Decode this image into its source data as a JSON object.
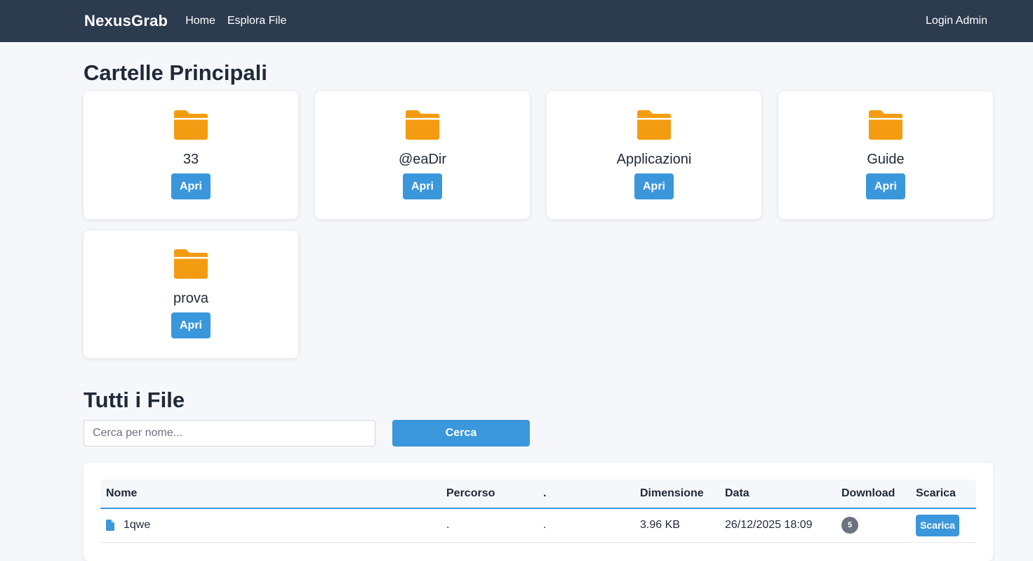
{
  "navbar": {
    "brand": "NexusGrab",
    "links": [
      "Home",
      "Esplora File"
    ],
    "login": "Login Admin"
  },
  "folders_section": {
    "title": "Cartelle Principali",
    "open_label": "Apri",
    "folders": [
      {
        "name": "33"
      },
      {
        "name": "@eaDir"
      },
      {
        "name": "Applicazioni"
      },
      {
        "name": "Guide"
      },
      {
        "name": "prova"
      }
    ]
  },
  "files_section": {
    "title": "Tutti i File",
    "search_placeholder": "Cerca per nome...",
    "search_button": "Cerca",
    "columns": [
      "Nome",
      "Percorso",
      ".",
      "Dimensione",
      "Data",
      "Download",
      "Scarica"
    ],
    "rows": [
      {
        "name": "1qwe",
        "path": ".",
        "dot": ".",
        "size": "3.96 KB",
        "date": "26/12/2025 18:09",
        "downloads": "5",
        "action": "Scarica"
      }
    ]
  },
  "colors": {
    "navbar_bg": "#2d3b4f",
    "accent": "#3b97db",
    "folder": "#f39c12",
    "page_bg": "#f5f7fa"
  },
  "icons": {
    "folder": "folder-icon",
    "file": "file-icon"
  }
}
